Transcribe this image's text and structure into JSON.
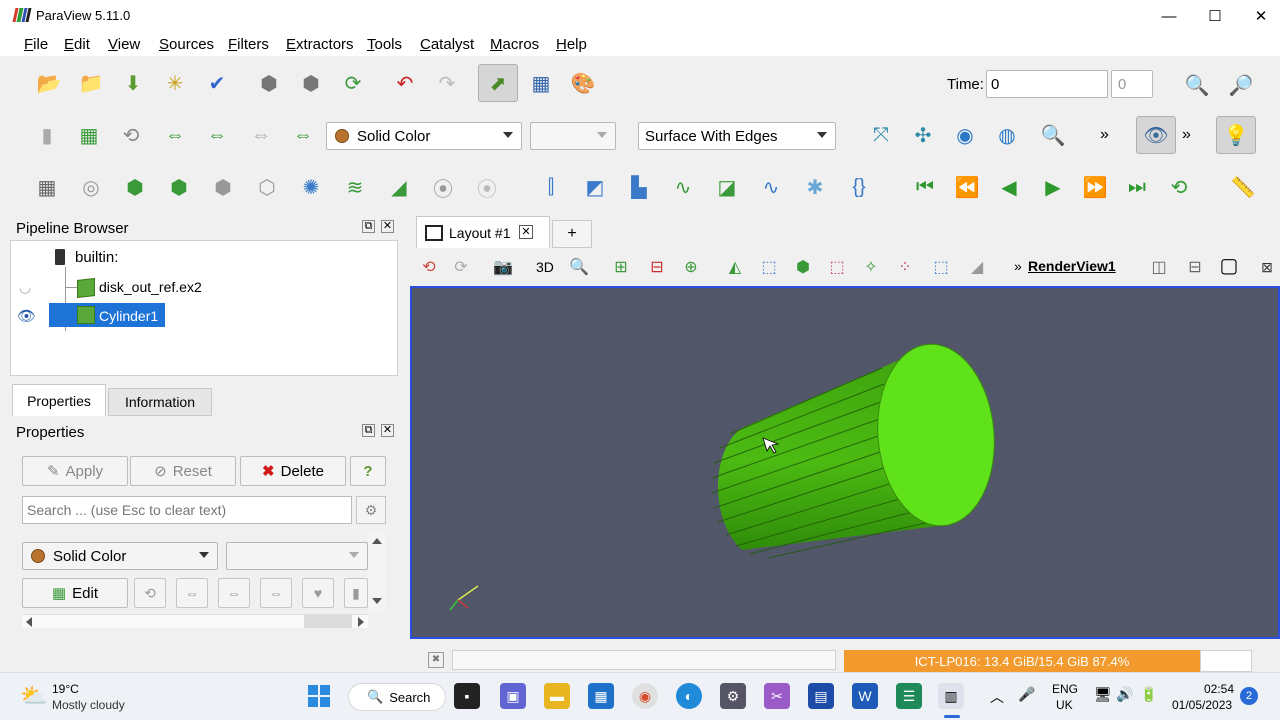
{
  "window": {
    "title": "ParaView 5.11.0",
    "min": "—",
    "max": "☐",
    "close": "✕"
  },
  "menu": [
    "File",
    "Edit",
    "View",
    "Sources",
    "Filters",
    "Extractors",
    "Tools",
    "Catalyst",
    "Macros",
    "Help"
  ],
  "toolbar": {
    "time_label": "Time:",
    "time_value": "0",
    "time_index": "0",
    "color_by": "Solid Color",
    "component": "",
    "representation": "Surface With Edges",
    "more": "»"
  },
  "pipeline": {
    "title": "Pipeline Browser",
    "builtin": "builtin:",
    "items": [
      {
        "label": "disk_out_ref.ex2",
        "visible": false
      },
      {
        "label": "Cylinder1",
        "visible": true,
        "selected": true
      }
    ]
  },
  "tabs": {
    "properties": "Properties",
    "information": "Information"
  },
  "properties": {
    "title": "Properties",
    "apply": "Apply",
    "reset": "Reset",
    "delete": "Delete",
    "help": "?",
    "search_placeholder": "Search ... (use Esc to clear text)",
    "color_by": "Solid Color",
    "edit": "Edit"
  },
  "layout": {
    "tab_label": "Layout #1",
    "add_tab": "+",
    "mode_3d": "3D",
    "render_view": "RenderView1",
    "more": "»"
  },
  "status": {
    "memory": "ICT-LP016: 13.4 GiB/15.4 GiB 87.4%"
  },
  "taskbar": {
    "weather_temp": "19°C",
    "weather_desc": "Mostly cloudy",
    "search": "Search",
    "lang1": "ENG",
    "lang2": "UK",
    "time": "02:54",
    "date": "01/05/2023",
    "notifications": "2"
  },
  "colors": {
    "render_bg": "#525669",
    "cylinder": "#4fc812",
    "selection": "#1e73d6",
    "memory_bar": "#f29a2e",
    "accent_border": "#2b4de0"
  }
}
